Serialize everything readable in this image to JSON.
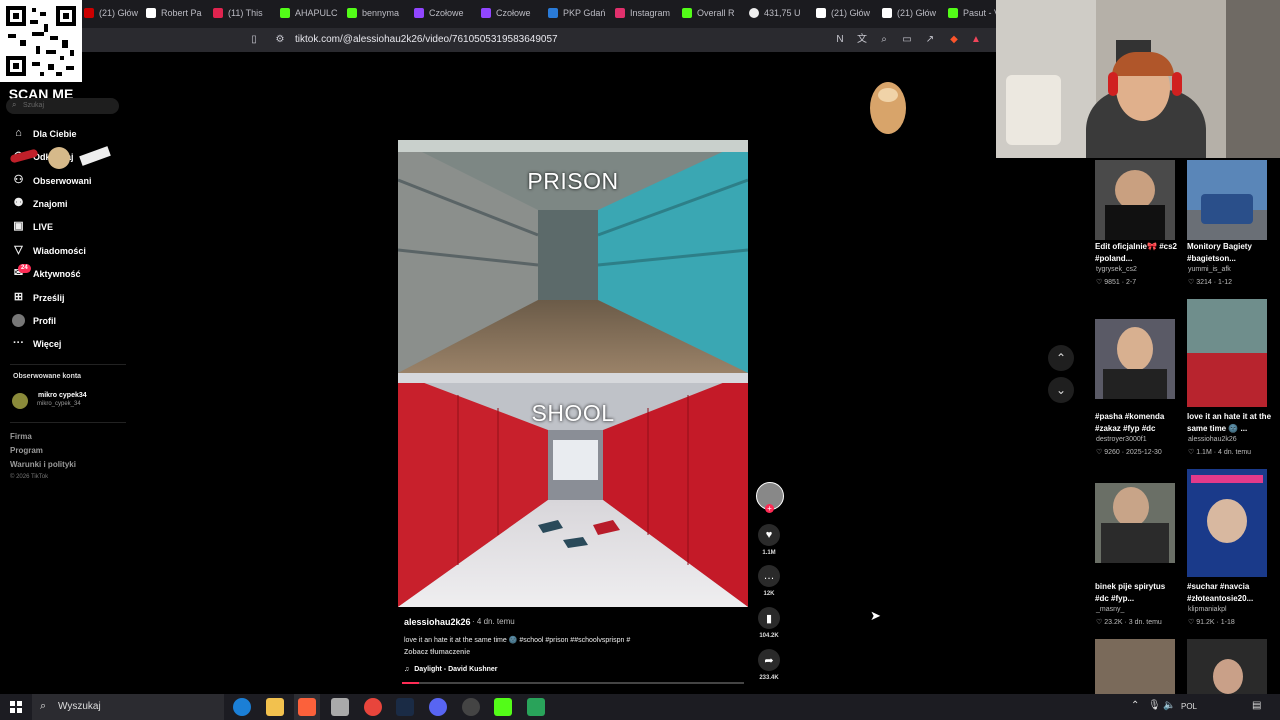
{
  "browser": {
    "tabs": [
      {
        "label": "(21) Głów",
        "color": "#c00"
      },
      {
        "label": "Robert Pa",
        "color": "#fff"
      },
      {
        "label": "(11) This",
        "color": "#e0244f"
      },
      {
        "label": "AHAPULC",
        "color": "#53fc18"
      },
      {
        "label": "bennyma",
        "color": "#53fc18"
      },
      {
        "label": "Czołowe",
        "color": "#9146ff"
      },
      {
        "label": "Czołowe",
        "color": "#9146ff"
      },
      {
        "label": "PKP Gdań",
        "color": "#2a7bd8"
      },
      {
        "label": "Instagram",
        "color": "#e1306c"
      },
      {
        "label": "Overall R",
        "color": "#53fc18"
      },
      {
        "label": "431,75 U",
        "color": "#eee"
      },
      {
        "label": "(21) Głów",
        "color": "#fff"
      },
      {
        "label": "(21) Głów",
        "color": "#fff"
      },
      {
        "label": "Pasut - V",
        "color": "#53fc18"
      }
    ],
    "url": "tiktok.com/@alessiohau2k26/video/7610505319583649057"
  },
  "overlay": {
    "scan_me": "SCAN ME"
  },
  "sidebar": {
    "search_placeholder": "Szukaj",
    "items": [
      {
        "label": "Dla Ciebie",
        "icon": "home-icon"
      },
      {
        "label": "Odkrywaj",
        "icon": "compass-icon"
      },
      {
        "label": "Obserwowani",
        "icon": "user-plus-icon"
      },
      {
        "label": "Znajomi",
        "icon": "friends-icon"
      },
      {
        "label": "LIVE",
        "icon": "live-icon"
      },
      {
        "label": "Wiadomości",
        "icon": "send-icon"
      },
      {
        "label": "Aktywność",
        "icon": "inbox-icon",
        "badge": "24"
      },
      {
        "label": "Prześlij",
        "icon": "upload-icon"
      },
      {
        "label": "Profil",
        "icon": "avatar-icon"
      },
      {
        "label": "Więcej",
        "icon": "more-icon"
      }
    ],
    "followed_heading": "Obserwowane konta",
    "followed": {
      "name": "mikro cypek34",
      "handle": "mikro_cypek_34"
    },
    "footer": [
      "Firma",
      "Program",
      "Warunki i polityki",
      "© 2026 TikTok"
    ]
  },
  "video": {
    "top_caption": "PRISON",
    "bottom_caption": "SHOOL",
    "author": "alessiohau2k26",
    "age": "4 dn. temu",
    "description": "love it an hate it at the same time 🌚 #school #prison ##schoolvsprispn #",
    "translate": "Zobacz tłumaczenie",
    "music": "Daylight - David Kushner",
    "progress": 0.05
  },
  "actions": {
    "likes": "1.1M",
    "comments": "12K",
    "saves": "104.2K",
    "shares": "233.4K"
  },
  "recommended": [
    {
      "title": "Edit oficjalnie🎀 #cs2 #poland...",
      "author": "tygrysek_cs2",
      "stats": "♡ 9851 · 2-7",
      "color": "#4a4a4a"
    },
    {
      "title": "Monitory Bagiety #bagietson...",
      "author": "yummi_is_afk",
      "stats": "♡ 3214 · 1-12",
      "color": "#3a6ea5"
    },
    {
      "title": "#pasha #komenda #zakaz #fyp #dc",
      "author": "destroyer3000f1",
      "stats": "♡ 9260 · 2025-12-30",
      "color": "#5a5a66"
    },
    {
      "title": "love it an hate it at the same time 🌚 ...",
      "author": "alessiohau2k26",
      "stats": "♡ 1.1M · 4 dn. temu",
      "color": "#5a8a8a"
    },
    {
      "title": "binek pije spirytus #dc #fyp...",
      "author": "_masny_",
      "stats": "♡ 23.2K · 3 dn. temu",
      "color": "#6a6f66"
    },
    {
      "title": "#suchar #navcia #złoteantosie20...",
      "author": "klipmaniakpl",
      "stats": "♡ 91.2K · 1-18",
      "color": "#1a3a8a"
    },
    {
      "title": "",
      "author": "",
      "stats": "",
      "color": "#7a6a5a"
    },
    {
      "title": "",
      "author": "",
      "stats": "",
      "color": "#2a2a2a"
    }
  ],
  "taskbar": {
    "search_placeholder": "Wyszukaj",
    "language": "POL"
  }
}
